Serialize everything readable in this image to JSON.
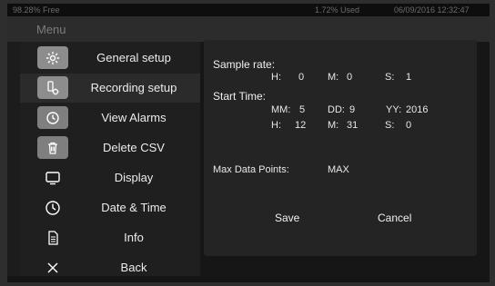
{
  "statusbar": {
    "left_text": "98.28% Free",
    "middle_text": "1.72% Used",
    "right_text": "06/09/2016 12:32:47"
  },
  "menubar": {
    "title": "Menu"
  },
  "sidebar": {
    "items": [
      {
        "label": "General setup",
        "icon": "gear-icon"
      },
      {
        "label": "Recording setup",
        "icon": "bottle-gear-icon"
      },
      {
        "label": "View Alarms",
        "icon": "clock-icon"
      },
      {
        "label": "Delete CSV",
        "icon": "trash-icon"
      },
      {
        "label": "Display",
        "icon": "monitor-icon"
      },
      {
        "label": "Date & Time",
        "icon": "clock-outline-icon"
      },
      {
        "label": "Info",
        "icon": "document-icon"
      },
      {
        "label": "Back",
        "icon": "close-icon"
      }
    ],
    "active_index": 1
  },
  "panel": {
    "sample_rate": {
      "label": "Sample rate:",
      "h_label": "H:",
      "h_value": "0",
      "m_label": "M:",
      "m_value": "0",
      "s_label": "S:",
      "s_value": "1"
    },
    "start_time": {
      "label": "Start Time:",
      "mm_label": "MM:",
      "mm_value": "5",
      "dd_label": "DD:",
      "dd_value": "9",
      "yy_label": "YY:",
      "yy_value": "2016",
      "h_label": "H:",
      "h_value": "12",
      "m_label": "M:",
      "m_value": "31",
      "s_label": "S:",
      "s_value": "0"
    },
    "max_points": {
      "label": "Max Data Points:",
      "value": "MAX"
    },
    "save_label": "Save",
    "cancel_label": "Cancel"
  },
  "colors": {
    "background": "#161616",
    "panel": "#242424",
    "sidebar": "#1f1f1f",
    "icon_tile": "#8d8d8d",
    "text": "#e8e8e8"
  }
}
